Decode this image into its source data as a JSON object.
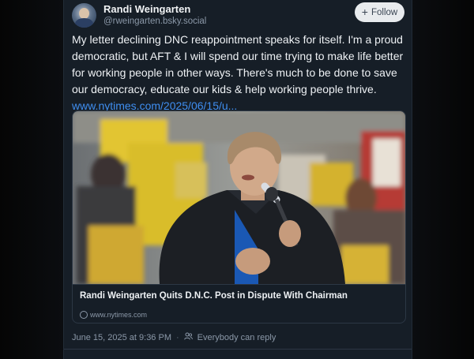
{
  "author": {
    "display_name": "Randi Weingarten",
    "handle": "@rweingarten.bsky.social"
  },
  "follow_button": {
    "label": "Follow"
  },
  "post": {
    "text": "My letter declining DNC reappointment speaks for itself. I'm a proud democratic, but AFT & I will spend our time trying to make life better for working people in other ways. There's much to be done to save our democracy, educate our kids  & help working people thrive.",
    "link_text": "www.nytimes.com/2025/06/15/u..."
  },
  "link_card": {
    "title": "Randi Weingarten Quits D.N.C. Post in Dispute With Chairman",
    "domain": "www.nytimes.com",
    "image_alt": "Photo of Randi Weingarten speaking into a microphone at a rally"
  },
  "meta": {
    "timestamp": "June 15, 2025 at 9:36 PM",
    "separator": "·",
    "reply_setting": "Everybody can reply"
  },
  "colors": {
    "background": "#161e27",
    "link": "#3f8ef0",
    "muted": "#8b98a8"
  },
  "icons": [
    "plus-icon",
    "globe-icon",
    "people-icon"
  ]
}
